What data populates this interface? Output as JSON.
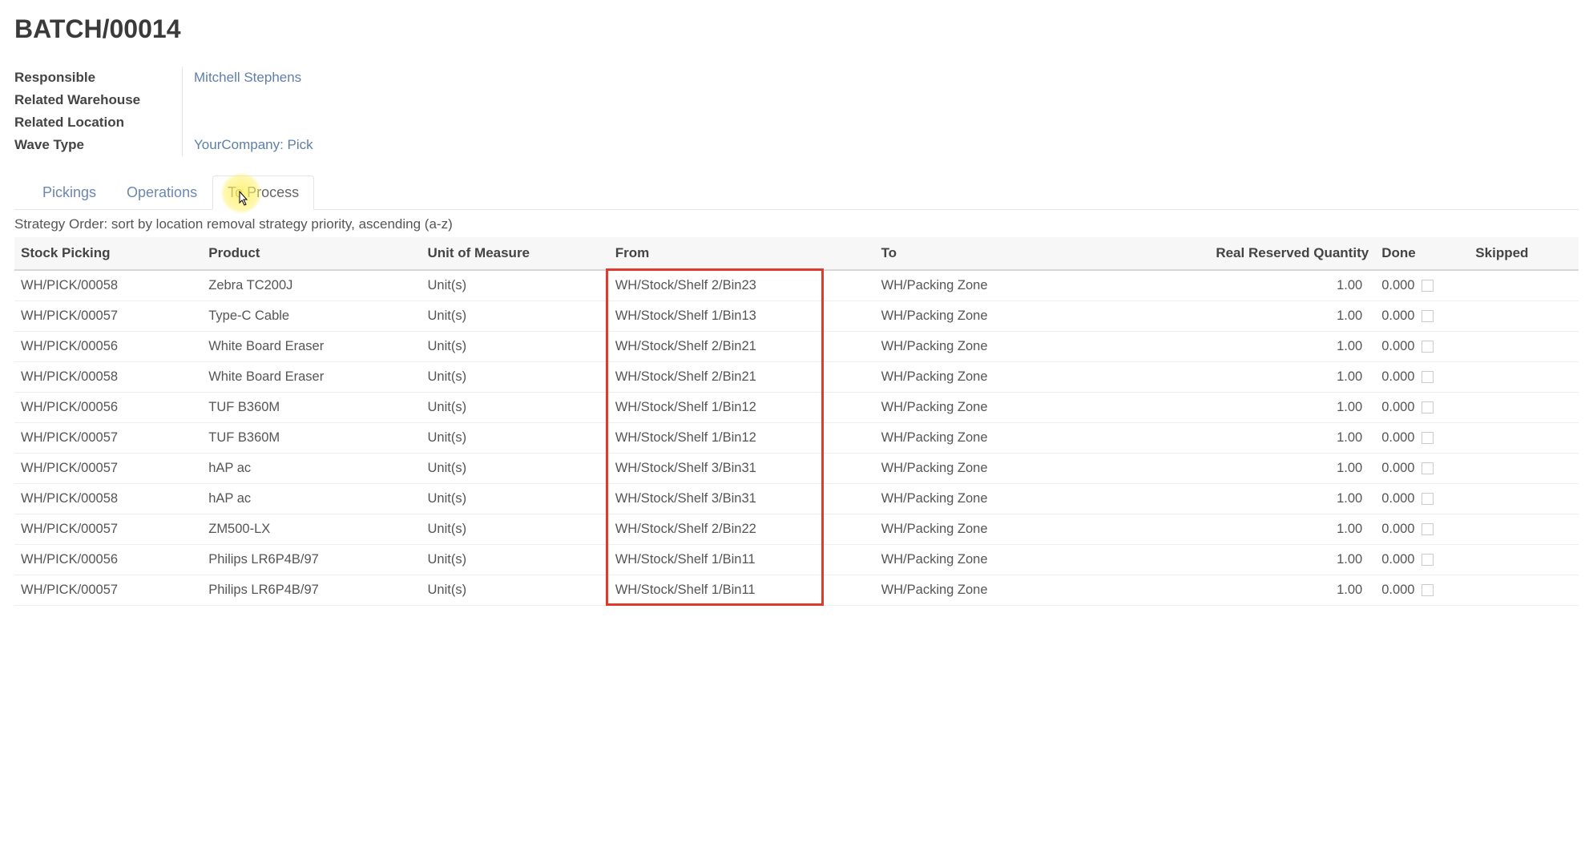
{
  "title": "BATCH/00014",
  "info": {
    "labels": {
      "responsible": "Responsible",
      "related_warehouse": "Related Warehouse",
      "related_location": "Related Location",
      "wave_type": "Wave Type"
    },
    "values": {
      "responsible": "Mitchell Stephens",
      "related_warehouse": "",
      "related_location": "",
      "wave_type": "YourCompany: Pick"
    }
  },
  "tabs": {
    "pickings": "Pickings",
    "operations": "Operations",
    "to_process": "To Process"
  },
  "strategy_text": "Strategy Order: sort by location removal strategy priority, ascending (a-z)",
  "columns": {
    "stock_picking": "Stock Picking",
    "product": "Product",
    "uom": "Unit of Measure",
    "from": "From",
    "to": "To",
    "reserved_qty": "Real Reserved Quantity",
    "done": "Done",
    "skipped": "Skipped"
  },
  "rows": [
    {
      "picking": "WH/PICK/00058",
      "product": "Zebra TC200J",
      "uom": "Unit(s)",
      "from": "WH/Stock/Shelf 2/Bin23",
      "to": "WH/Packing Zone",
      "qty": "1.00",
      "done": "0.000"
    },
    {
      "picking": "WH/PICK/00057",
      "product": "Type-C Cable",
      "uom": "Unit(s)",
      "from": "WH/Stock/Shelf 1/Bin13",
      "to": "WH/Packing Zone",
      "qty": "1.00",
      "done": "0.000"
    },
    {
      "picking": "WH/PICK/00056",
      "product": "White Board Eraser",
      "uom": "Unit(s)",
      "from": "WH/Stock/Shelf 2/Bin21",
      "to": "WH/Packing Zone",
      "qty": "1.00",
      "done": "0.000"
    },
    {
      "picking": "WH/PICK/00058",
      "product": "White Board Eraser",
      "uom": "Unit(s)",
      "from": "WH/Stock/Shelf 2/Bin21",
      "to": "WH/Packing Zone",
      "qty": "1.00",
      "done": "0.000"
    },
    {
      "picking": "WH/PICK/00056",
      "product": "TUF B360M",
      "uom": "Unit(s)",
      "from": "WH/Stock/Shelf 1/Bin12",
      "to": "WH/Packing Zone",
      "qty": "1.00",
      "done": "0.000"
    },
    {
      "picking": "WH/PICK/00057",
      "product": "TUF B360M",
      "uom": "Unit(s)",
      "from": "WH/Stock/Shelf 1/Bin12",
      "to": "WH/Packing Zone",
      "qty": "1.00",
      "done": "0.000"
    },
    {
      "picking": "WH/PICK/00057",
      "product": "hAP ac",
      "uom": "Unit(s)",
      "from": "WH/Stock/Shelf 3/Bin31",
      "to": "WH/Packing Zone",
      "qty": "1.00",
      "done": "0.000"
    },
    {
      "picking": "WH/PICK/00058",
      "product": "hAP ac",
      "uom": "Unit(s)",
      "from": "WH/Stock/Shelf 3/Bin31",
      "to": "WH/Packing Zone",
      "qty": "1.00",
      "done": "0.000"
    },
    {
      "picking": "WH/PICK/00057",
      "product": "ZM500-LX",
      "uom": "Unit(s)",
      "from": "WH/Stock/Shelf 2/Bin22",
      "to": "WH/Packing Zone",
      "qty": "1.00",
      "done": "0.000"
    },
    {
      "picking": "WH/PICK/00056",
      "product": "Philips LR6P4B/97",
      "uom": "Unit(s)",
      "from": "WH/Stock/Shelf 1/Bin11",
      "to": "WH/Packing Zone",
      "qty": "1.00",
      "done": "0.000"
    },
    {
      "picking": "WH/PICK/00057",
      "product": "Philips LR6P4B/97",
      "uom": "Unit(s)",
      "from": "WH/Stock/Shelf 1/Bin11",
      "to": "WH/Packing Zone",
      "qty": "1.00",
      "done": "0.000"
    }
  ]
}
